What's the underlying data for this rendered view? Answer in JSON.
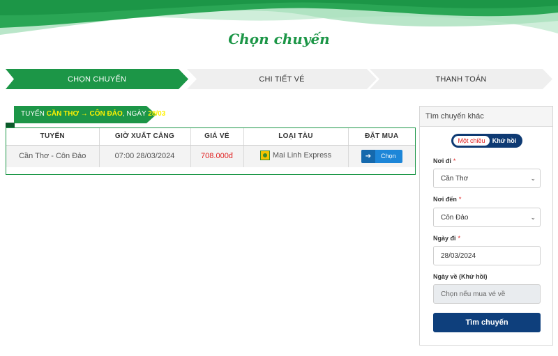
{
  "page": {
    "title": "Chọn chuyến"
  },
  "steps": [
    {
      "label": "CHỌN CHUYẾN"
    },
    {
      "label": "CHI TIẾT VÉ"
    },
    {
      "label": "THANH TOÁN"
    }
  ],
  "route_banner": {
    "prefix": "TUYẾN ",
    "origin": "CẦN THƠ",
    "arrow": " → ",
    "destination": "CÔN ĐẢO",
    "date_prefix": ", NGÀY ",
    "date": "28/03"
  },
  "trips_table": {
    "headers": [
      "TUYẾN",
      "GIỜ XUẤT CẢNG",
      "GIÁ VÉ",
      "LOẠI TÀU",
      "ĐẶT MUA"
    ],
    "rows": [
      {
        "route": "Cần Thơ - Côn Đảo",
        "departure": "07:00 28/03/2024",
        "price": "708.000đ",
        "ship": "Mai Linh Express",
        "action": "Chọn"
      }
    ]
  },
  "search_panel": {
    "title": "Tìm chuyến khác",
    "trip_type": {
      "one_way": "Một chiều",
      "round_trip": "Khứ hồi",
      "selected": "Một chiều"
    },
    "from": {
      "label": "Nơi đi",
      "required": "*",
      "value": "Cần Thơ"
    },
    "to": {
      "label": "Nơi đến",
      "required": "*",
      "value": "Côn Đảo"
    },
    "depart_date": {
      "label": "Ngày đi",
      "required": "*",
      "value": "28/03/2024"
    },
    "return_date": {
      "label": "Ngày về (Khứ hồi)",
      "placeholder": "Chọn nếu mua vé về"
    },
    "submit": "Tìm chuyến"
  },
  "colors": {
    "primary_green": "#1c9647",
    "navy": "#0e3f7c",
    "price_red": "#e02020",
    "highlight_yellow": "#fff200"
  },
  "icons": {
    "step_arrow": "chevron-shape",
    "choose": "arrow-right-icon",
    "ship_logo": "mai-linh-logo",
    "select": "chevron-down-icon"
  }
}
